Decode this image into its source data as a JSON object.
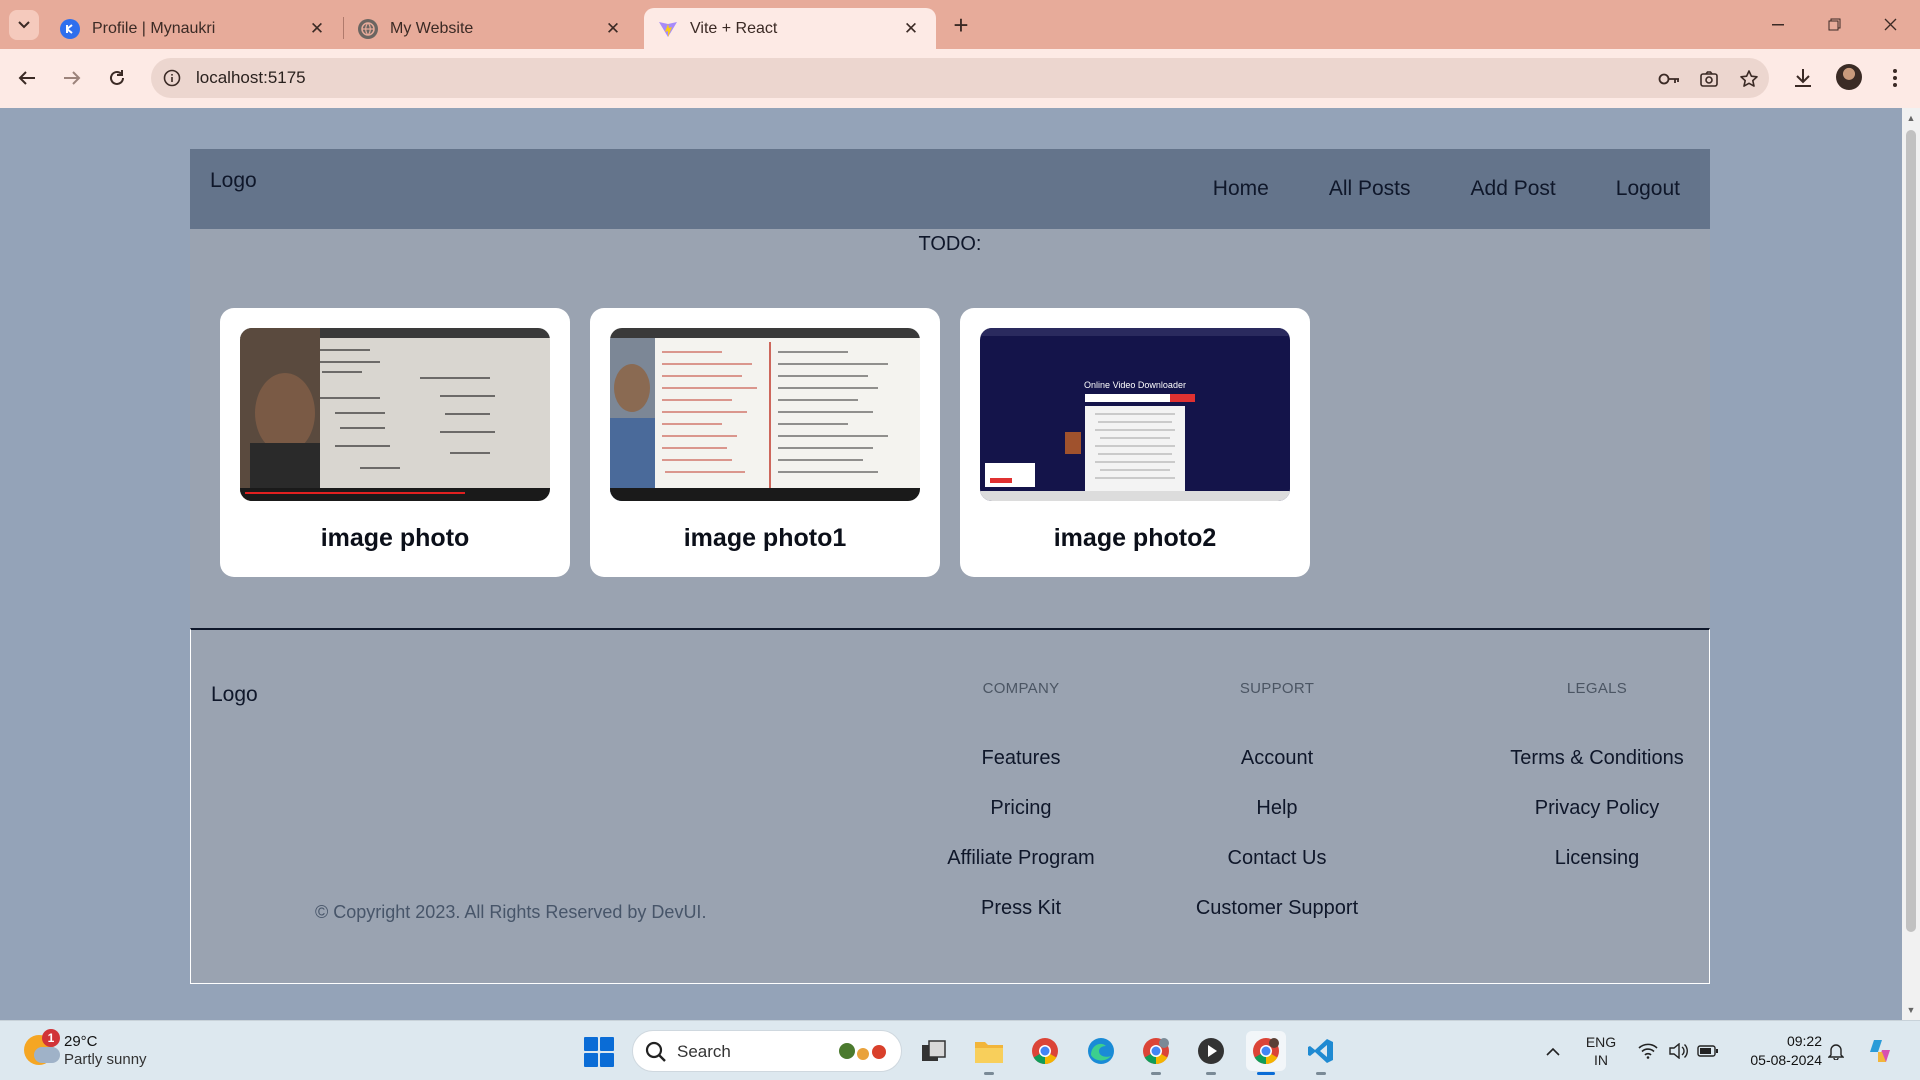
{
  "browser": {
    "tabs": [
      {
        "title": "Profile | Mynaukri",
        "active": false
      },
      {
        "title": "My Website",
        "active": false
      },
      {
        "title": "Vite + React",
        "active": true
      }
    ],
    "url": "localhost:5175"
  },
  "header": {
    "logo": "Logo",
    "nav": [
      "Home",
      "All Posts",
      "Add Post",
      "Logout"
    ]
  },
  "main": {
    "todo_label": "TODO:",
    "posts": [
      {
        "title": "image photo",
        "thumb_icon": "whiteboard-video-thumbnail"
      },
      {
        "title": "image photo1",
        "thumb_icon": "whiteboard-video-thumbnail"
      },
      {
        "title": "image photo2",
        "thumb_icon": "online-video-downloader-screenshot"
      }
    ]
  },
  "footer": {
    "logo": "Logo",
    "copyright": "© Copyright 2023. All Rights Reserved by DevUI.",
    "columns": [
      {
        "heading": "COMPANY",
        "links": [
          "Features",
          "Pricing",
          "Affiliate Program",
          "Press Kit"
        ]
      },
      {
        "heading": "SUPPORT",
        "links": [
          "Account",
          "Help",
          "Contact Us",
          "Customer Support"
        ]
      },
      {
        "heading": "LEGALS",
        "links": [
          "Terms & Conditions",
          "Privacy Policy",
          "Licensing"
        ]
      }
    ]
  },
  "taskbar": {
    "weather": {
      "temp": "29°C",
      "condition": "Partly sunny",
      "badge": "1"
    },
    "search_label": "Search",
    "language": "ENG",
    "region": "IN",
    "time": "09:22",
    "date": "05-08-2024"
  },
  "colors": {
    "tabbar": "#e7ab9a",
    "toolbar": "#fdeae5",
    "page_bg": "#94a3b8",
    "header_bg": "#64748b",
    "card_bg": "#ffffff"
  }
}
